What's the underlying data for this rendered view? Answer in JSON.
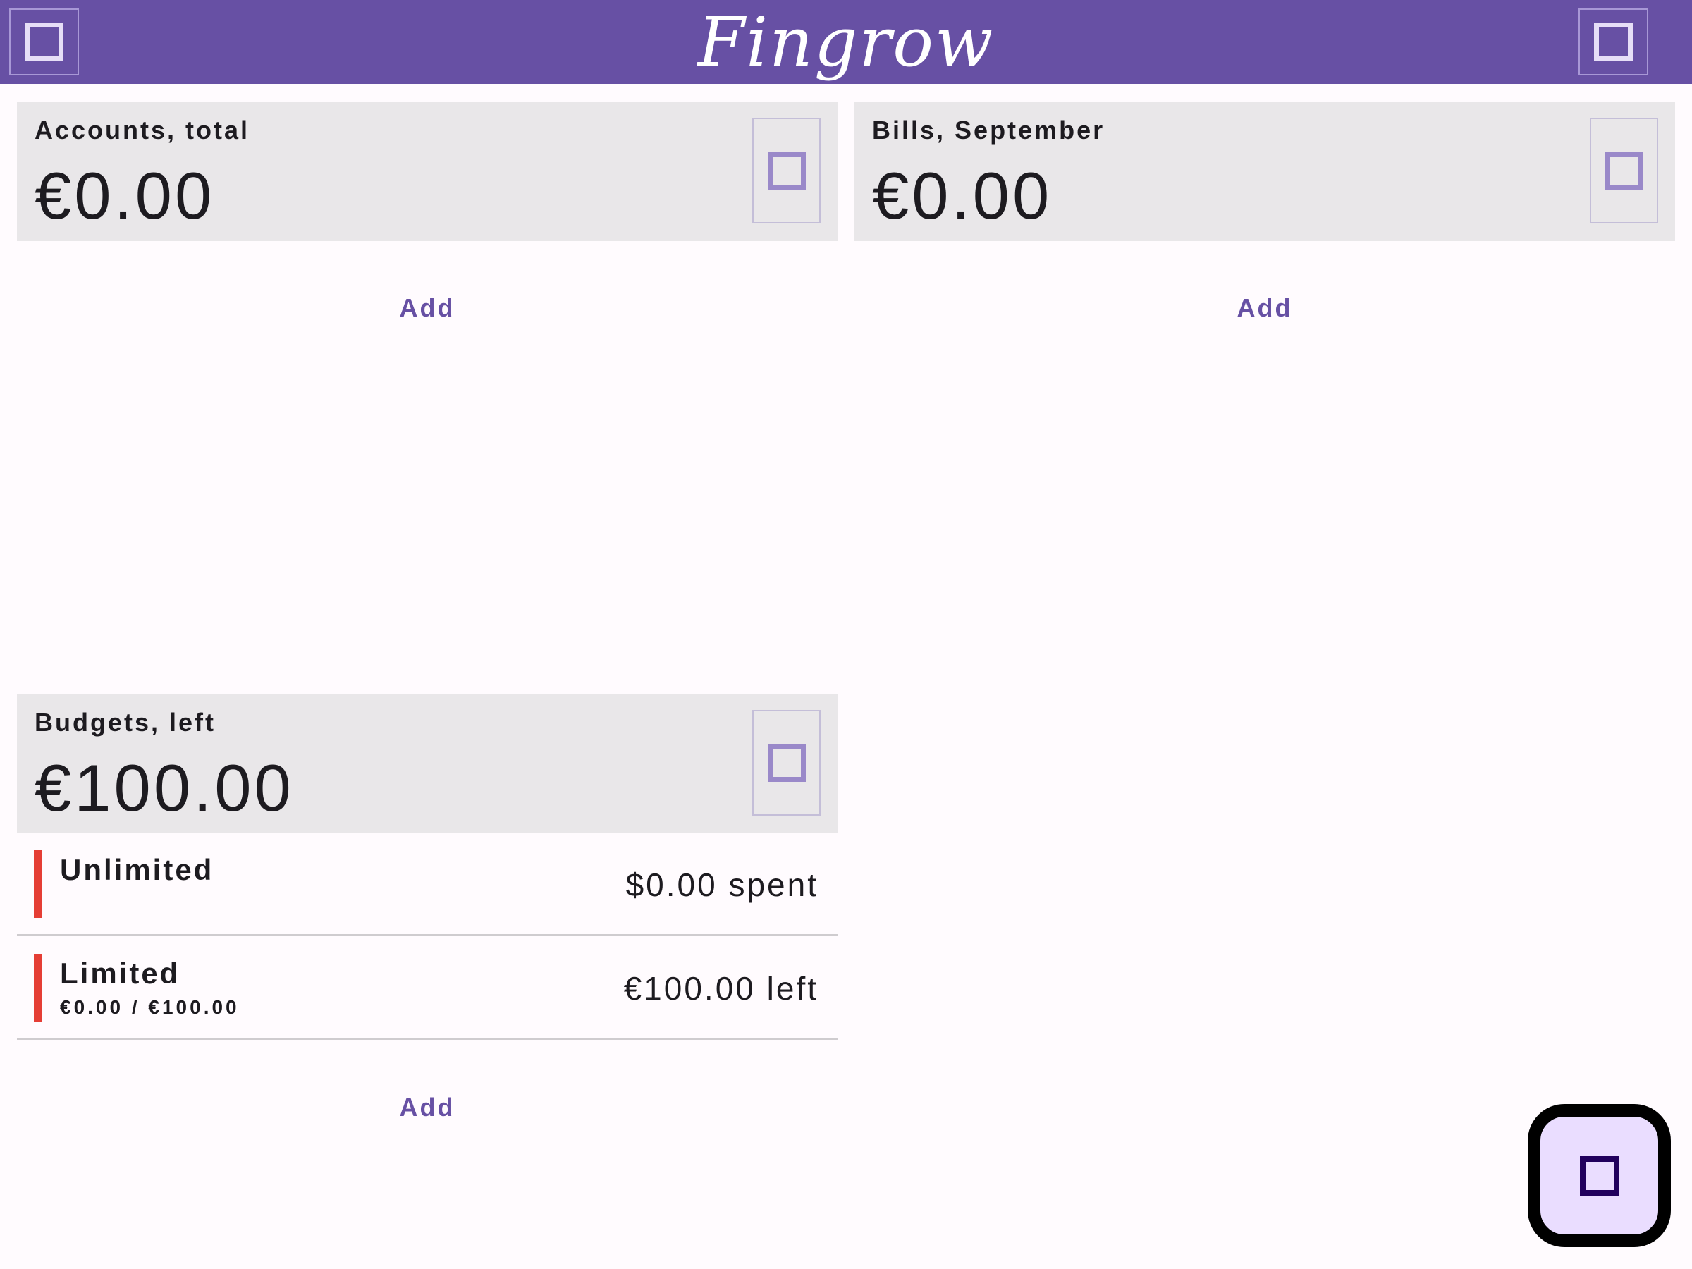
{
  "app": {
    "title": "Fingrow",
    "accent_color": "#6750a4",
    "left_action_icon": "square-icon",
    "right_action_icon": "square-icon"
  },
  "cards": {
    "accounts": {
      "title": "Accounts, total",
      "amount": "€0.00",
      "action_icon": "square-icon",
      "add_label": "Add"
    },
    "bills": {
      "title": "Bills, September",
      "amount": "€0.00",
      "action_icon": "square-icon",
      "add_label": "Add"
    },
    "budgets": {
      "title": "Budgets, left",
      "amount": "€100.00",
      "action_icon": "square-icon",
      "add_label": "Add",
      "items": [
        {
          "name": "Unlimited",
          "progress": "",
          "status": "$0.00 spent",
          "color": "#e53e35"
        },
        {
          "name": "Limited",
          "progress": "€0.00 / €100.00",
          "status": "€100.00 left",
          "color": "#e53e35"
        }
      ]
    }
  },
  "fab": {
    "icon": "square-icon",
    "background": "#eaddff"
  }
}
